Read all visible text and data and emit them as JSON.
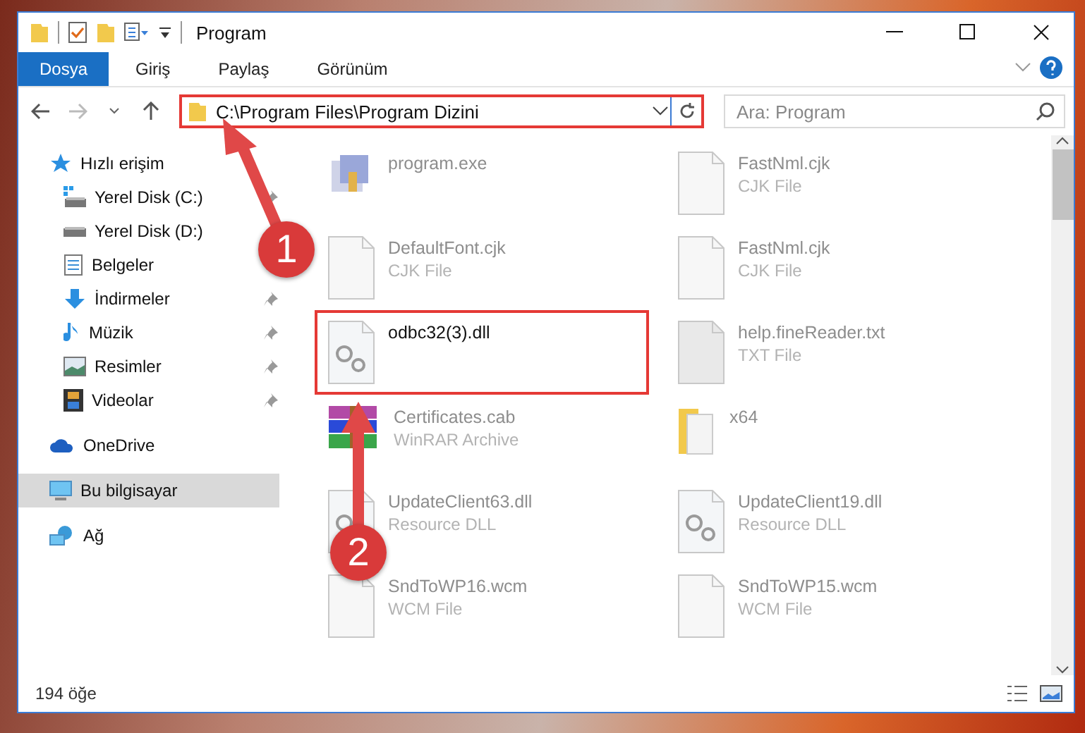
{
  "window": {
    "title": "Program"
  },
  "ribbon_tabs": [
    {
      "label": "Dosya",
      "selected": true
    },
    {
      "label": "Giriş",
      "selected": false
    },
    {
      "label": "Paylaş",
      "selected": false
    },
    {
      "label": "Görünüm",
      "selected": false
    }
  ],
  "address_bar": {
    "path": "C:\\Program Files\\Program Dizini",
    "annotated": true
  },
  "search": {
    "placeholder": "Ara: Program"
  },
  "sidebar": {
    "items": [
      {
        "label": "Hızlı erişim",
        "kind": "quick-access",
        "selected": false,
        "children": [
          {
            "label": "Yerel Disk (C:)",
            "kind": "system-drive",
            "pinned": true,
            "selected": false
          },
          {
            "label": "Yerel Disk (D:)",
            "kind": "drive",
            "selected": false
          },
          {
            "label": "Belgeler",
            "kind": "documents",
            "selected": false
          },
          {
            "label": "İndirmeler",
            "kind": "downloads",
            "pinned": true,
            "selected": false
          },
          {
            "label": "Müzik",
            "kind": "music",
            "pinned": true,
            "selected": false
          },
          {
            "label": "Resimler",
            "kind": "pictures",
            "pinned": true,
            "selected": false
          },
          {
            "label": "Videolar",
            "kind": "videos",
            "pinned": true,
            "selected": false
          }
        ]
      },
      {
        "label": "OneDrive",
        "kind": "cloud",
        "selected": false
      },
      {
        "label": "Bu bilgisayar",
        "kind": "computer",
        "selected": true
      },
      {
        "label": "Ağ",
        "kind": "network",
        "selected": false
      }
    ]
  },
  "files": [
    {
      "name": "program.exe",
      "kind": "exe",
      "annotated": false
    },
    {
      "name": "FastNml.cjk",
      "type": "CJK File",
      "kind": "blank",
      "annotated": false
    },
    {
      "name": "DefaultFont.cjk",
      "type": "CJK File",
      "kind": "blank",
      "annotated": false
    },
    {
      "name": "FastNml.cjk",
      "type": "CJK File",
      "kind": "blank",
      "annotated": false
    },
    {
      "name": "odbc32(3).dll",
      "kind": "gear",
      "annotated": true
    },
    {
      "name": "help.fineReader.txt",
      "type": "TXT File",
      "kind": "text",
      "annotated": false
    },
    {
      "name": "Certificates.cab",
      "type": "WinRAR Archive",
      "kind": "archive",
      "annotated": false
    },
    {
      "name": "x64",
      "kind": "folder",
      "annotated": false
    },
    {
      "name": "UpdateClient63.dll",
      "type": "Resource DLL",
      "kind": "gear",
      "annotated": false
    },
    {
      "name": "UpdateClient19.dll",
      "type": "Resource DLL",
      "kind": "gear",
      "annotated": false
    },
    {
      "name": "SndToWP16.wcm",
      "type": "WCM File",
      "kind": "blank",
      "annotated": false
    },
    {
      "name": "SndToWP15.wcm",
      "type": "WCM File",
      "kind": "blank",
      "annotated": false
    }
  ],
  "annotations": [
    {
      "number": "1"
    },
    {
      "number": "2"
    }
  ],
  "status_bar": {
    "item_count": "194 öğe"
  }
}
